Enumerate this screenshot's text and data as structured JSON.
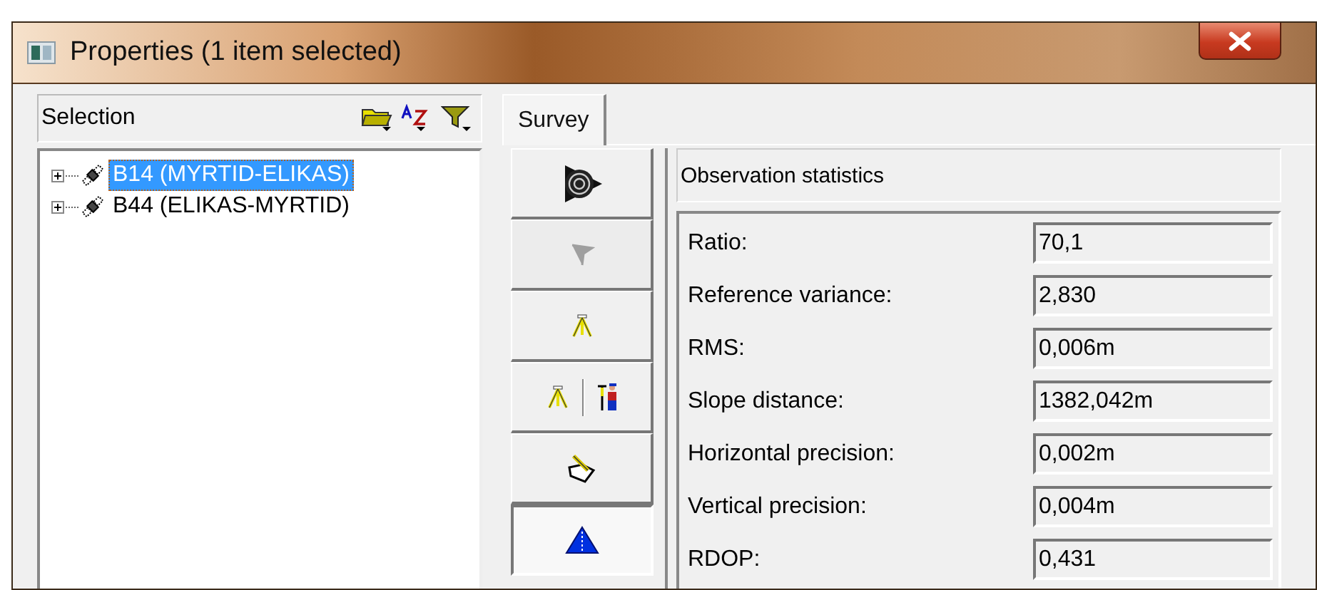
{
  "window": {
    "title": "Properties (1 item selected)"
  },
  "selection_panel": {
    "title": "Selection"
  },
  "tree": [
    {
      "label": "B14 (MYRTID-ELIKAS)",
      "selected": true,
      "expanded": false
    },
    {
      "label": "B44 (ELIKAS-MYRTID)",
      "selected": false,
      "expanded": false
    }
  ],
  "tabs": [
    {
      "label": "Survey",
      "selected": true
    }
  ],
  "tool_buttons": [
    {
      "kind": "target",
      "selected": false,
      "disabled": false
    },
    {
      "kind": "flag",
      "selected": false,
      "disabled": true
    },
    {
      "kind": "tripod",
      "selected": false,
      "disabled": false
    },
    {
      "kind": "tripod_surveyor",
      "selected": false,
      "disabled": false
    },
    {
      "kind": "pencil",
      "selected": false,
      "disabled": false
    },
    {
      "kind": "triangle",
      "selected": true,
      "disabled": false
    }
  ],
  "stats": {
    "title": "Observation statistics",
    "rows": [
      {
        "label": "Ratio:",
        "value": "70,1"
      },
      {
        "label": "Reference variance:",
        "value": "2,830"
      },
      {
        "label": "RMS:",
        "value": "0,006m"
      },
      {
        "label": "Slope distance:",
        "value": "1382,042m"
      },
      {
        "label": "Horizontal precision:",
        "value": "0,002m"
      },
      {
        "label": "Vertical precision:",
        "value": "0,004m"
      },
      {
        "label": "RDOP:",
        "value": "0,431"
      }
    ]
  }
}
